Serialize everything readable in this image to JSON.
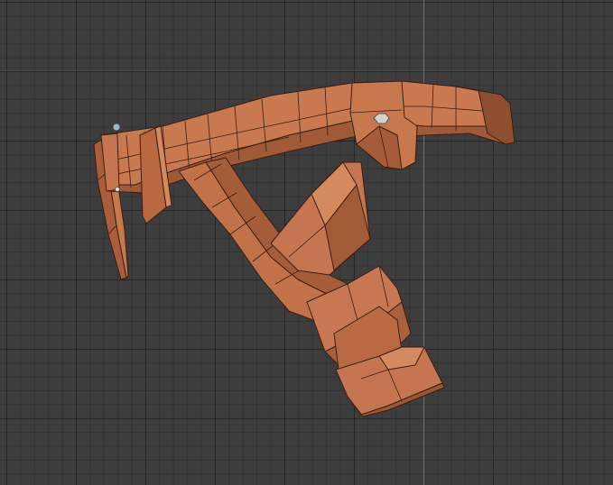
{
  "viewport": {
    "background_color": "#3d3d3d",
    "axis_y_color": "#5479a8",
    "mesh_base_color": "#c0714a",
    "mesh_edge_color": "#3a1f10",
    "icons": [
      "vertex-gizmo-icon"
    ]
  }
}
